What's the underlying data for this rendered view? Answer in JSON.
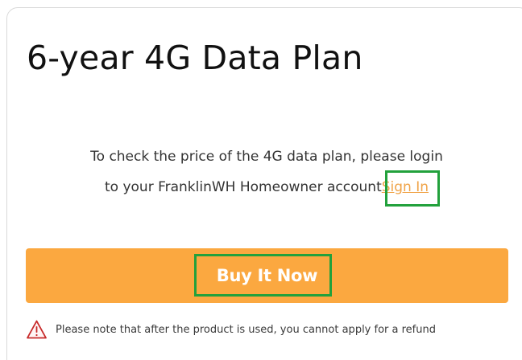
{
  "plan": {
    "title": "6-year 4G Data Plan"
  },
  "message": {
    "line1": "To check the price of the 4G data plan, please login",
    "line2_prefix": "to your FranklinWH Homeowner account",
    "sign_in_link": "Sign In"
  },
  "actions": {
    "buy_label": "Buy It Now"
  },
  "notice": {
    "icon": "warning-triangle-icon",
    "text": "Please note that after the product is used, you cannot apply for a refund"
  },
  "colors": {
    "accent": "#fba840",
    "link": "#f0a347",
    "highlight": "#22a13c",
    "warning": "#c62828"
  }
}
